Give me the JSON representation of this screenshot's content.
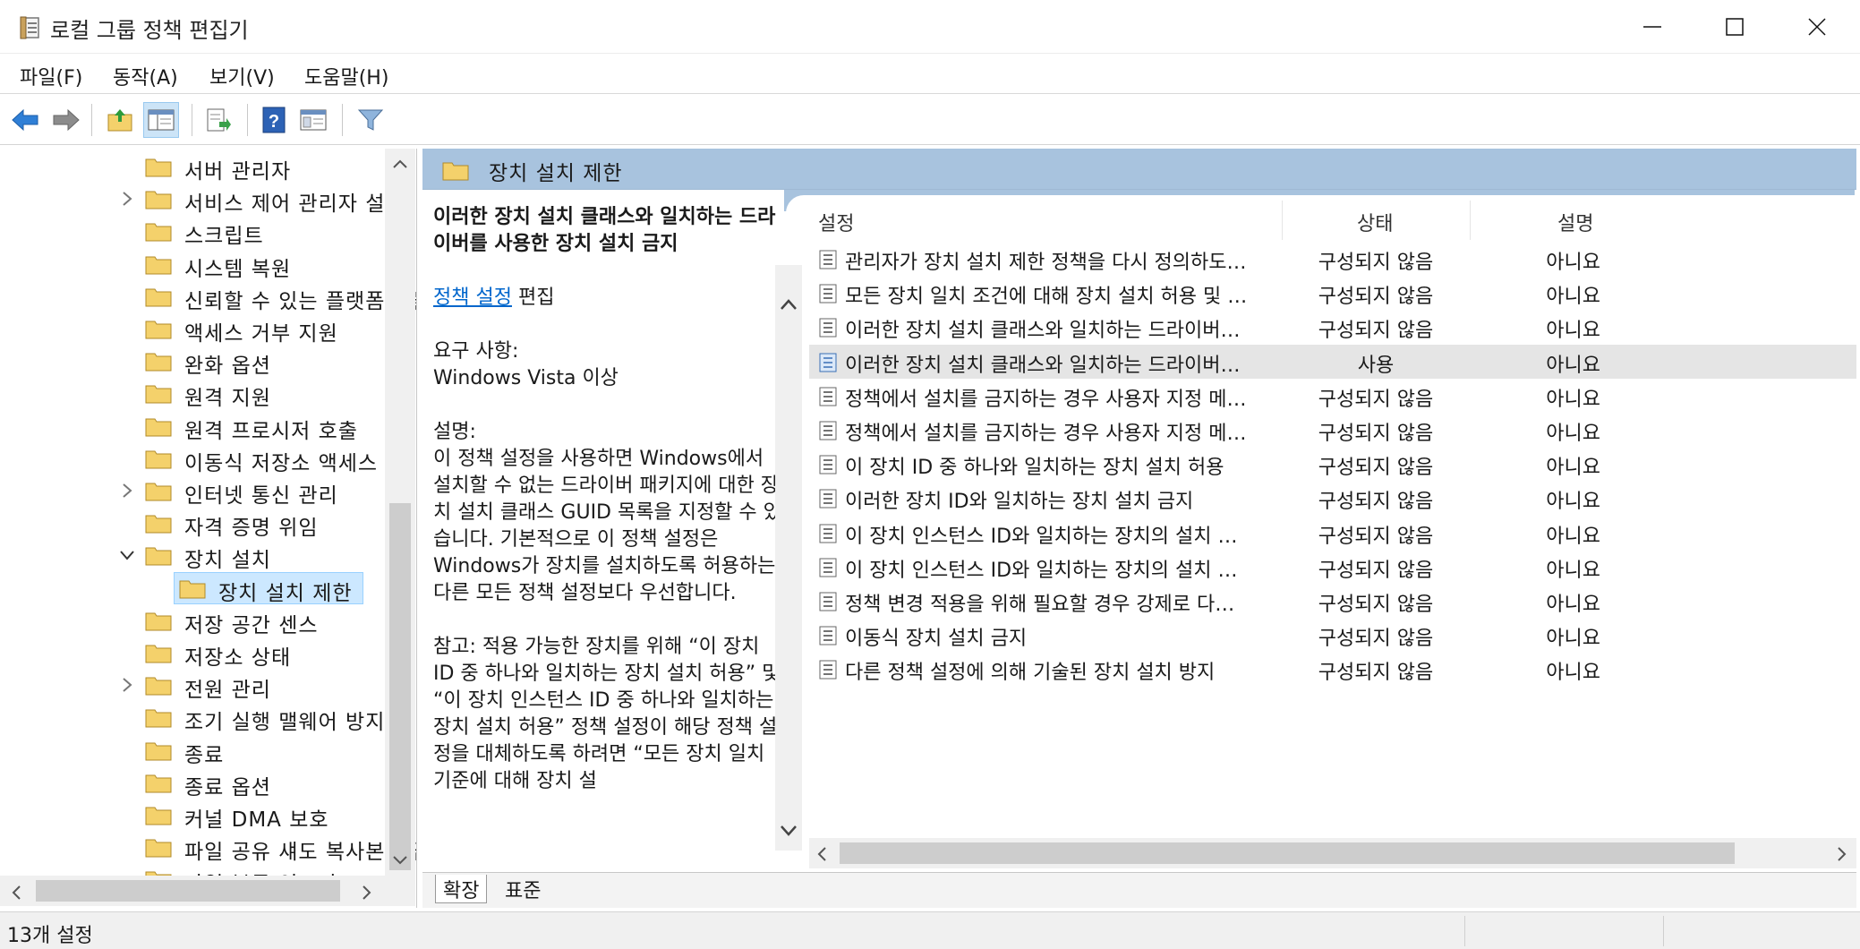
{
  "window": {
    "title": "로컬 그룹 정책 편집기"
  },
  "menu": {
    "file": "파일(F)",
    "action": "동작(A)",
    "view": "보기(V)",
    "help": "도움말(H)"
  },
  "tree": {
    "items": [
      {
        "label": "서버 관리자",
        "expander": "none",
        "level": 1
      },
      {
        "label": "서비스 제어 관리자 설정",
        "expander": "collapsed",
        "level": 1
      },
      {
        "label": "스크립트",
        "expander": "none",
        "level": 1
      },
      {
        "label": "시스템 복원",
        "expander": "none",
        "level": 1
      },
      {
        "label": "신뢰할 수 있는 플랫폼 모듈 서비스",
        "expander": "none",
        "level": 1
      },
      {
        "label": "액세스 거부 지원",
        "expander": "none",
        "level": 1
      },
      {
        "label": "완화 옵션",
        "expander": "none",
        "level": 1
      },
      {
        "label": "원격 지원",
        "expander": "none",
        "level": 1
      },
      {
        "label": "원격 프로시저 호출",
        "expander": "none",
        "level": 1
      },
      {
        "label": "이동식 저장소 액세스",
        "expander": "none",
        "level": 1
      },
      {
        "label": "인터넷 통신 관리",
        "expander": "collapsed",
        "level": 1
      },
      {
        "label": "자격 증명 위임",
        "expander": "none",
        "level": 1
      },
      {
        "label": "장치 설치",
        "expander": "expanded",
        "level": 1
      },
      {
        "label": "장치 설치 제한",
        "expander": "none",
        "level": 2,
        "selected": true
      },
      {
        "label": "저장 공간 센스",
        "expander": "none",
        "level": 1
      },
      {
        "label": "저장소 상태",
        "expander": "none",
        "level": 1
      },
      {
        "label": "전원 관리",
        "expander": "collapsed",
        "level": 1
      },
      {
        "label": "조기 실행 맬웨어 방지",
        "expander": "none",
        "level": 1
      },
      {
        "label": "종료",
        "expander": "none",
        "level": 1
      },
      {
        "label": "종료 옵션",
        "expander": "none",
        "level": 1
      },
      {
        "label": "커널 DMA 보호",
        "expander": "none",
        "level": 1
      },
      {
        "label": "파일 공유 섀도 복사본 공급자",
        "expander": "none",
        "level": 1
      },
      {
        "label": "파일 분류 인프라",
        "expander": "none",
        "level": 1
      }
    ]
  },
  "header": {
    "title": "장치 설치 제한"
  },
  "description": {
    "title": "이러한 장치 설치 클래스와 일치하는 드라이버를 사용한 장치 설치 금지",
    "link": "정책 설정",
    "edit": "편집",
    "req_label": "요구 사항:",
    "req_value": "Windows Vista 이상",
    "desc_label": "설명:",
    "desc_body": "이 정책 설정을 사용하면 Windows에서 설치할 수 없는 드라이버 패키지에 대한 장치 설치 클래스 GUID 목록을 지정할 수 있습니다. 기본적으로 이 정책 설정은 Windows가 장치를 설치하도록 허용하는 다른 모든 정책 설정보다 우선합니다.",
    "note": "참고: 적용 가능한 장치를 위해 “이 장치 ID 중 하나와 일치하는 장치 설치 허용” 및 “이 장치 인스턴스 ID 중 하나와 일치하는 장치 설치 허용” 정책 설정이 해당 정책 설정을 대체하도록 하려면 “모든 장치 일치 기준에 대해 장치 설"
  },
  "list": {
    "columns": {
      "setting": "설정",
      "state": "상태",
      "comment": "설명"
    },
    "rows": [
      {
        "name": "관리자가 장치 설치 제한 정책을 다시 정의하도록 허용",
        "state": "구성되지 않음",
        "comment": "아니요",
        "selected": false
      },
      {
        "name": "모든 장치 일치 조건에 대해 장치 설치 허용 및 방지 정책에...",
        "state": "구성되지 않음",
        "comment": "아니요",
        "selected": false
      },
      {
        "name": "이러한 장치 설치 클래스와 일치하는 드라이버를 사용한 장...",
        "state": "구성되지 않음",
        "comment": "아니요",
        "selected": false
      },
      {
        "name": "이러한 장치 설치 클래스와 일치하는 드라이버를 사용한 장...",
        "state": "사용",
        "comment": "아니요",
        "selected": true
      },
      {
        "name": "정책에서 설치를 금지하는 경우 사용자 지정 메시지 표시(...",
        "state": "구성되지 않음",
        "comment": "아니요",
        "selected": false
      },
      {
        "name": "정책에서 설치를 금지하는 경우 사용자 지정 메시지 표시(...",
        "state": "구성되지 않음",
        "comment": "아니요",
        "selected": false
      },
      {
        "name": "이 장치 ID 중 하나와 일치하는 장치 설치 허용",
        "state": "구성되지 않음",
        "comment": "아니요",
        "selected": false
      },
      {
        "name": "이러한 장치 ID와 일치하는 장치 설치 금지",
        "state": "구성되지 않음",
        "comment": "아니요",
        "selected": false
      },
      {
        "name": "이 장치 인스턴스 ID와 일치하는 장치의 설치 허용",
        "state": "구성되지 않음",
        "comment": "아니요",
        "selected": false
      },
      {
        "name": "이 장치 인스턴스 ID와 일치하는 장치의 설치 방지",
        "state": "구성되지 않음",
        "comment": "아니요",
        "selected": false
      },
      {
        "name": "정책 변경 적용을 위해 필요할 경우 강제로 다시 부팅을 실...",
        "state": "구성되지 않음",
        "comment": "아니요",
        "selected": false
      },
      {
        "name": "이동식 장치 설치 금지",
        "state": "구성되지 않음",
        "comment": "아니요",
        "selected": false
      },
      {
        "name": "다른 정책 설정에 의해 기술된 장치 설치 방지",
        "state": "구성되지 않음",
        "comment": "아니요",
        "selected": false
      }
    ]
  },
  "tabs": {
    "extended": "확장",
    "standard": "표준"
  },
  "status": {
    "text": "13개 설정"
  },
  "colors": {
    "header_bg": "#a8c3de",
    "selection_bg": "#cce8ff",
    "link": "#0066cc",
    "folder": "#f4d16b"
  },
  "icons": {
    "back": "back-arrow-icon",
    "forward": "forward-arrow-icon",
    "up": "folder-up-icon",
    "show_hide_tree": "show-hide-tree-icon",
    "export": "export-list-icon",
    "help": "help-icon",
    "properties": "properties-icon",
    "filter": "filter-icon"
  }
}
